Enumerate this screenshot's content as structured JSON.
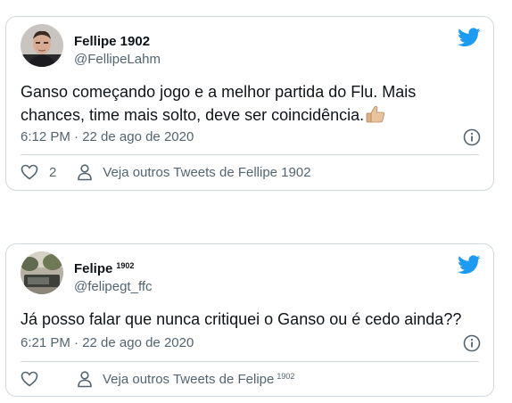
{
  "colors": {
    "twitter_blue": "#1d9bf0",
    "text_primary": "#0f1419",
    "text_secondary": "#536471",
    "border": "#cfd9de"
  },
  "tweets": [
    {
      "author": {
        "name": "Fellipe 1902",
        "name_superscript": "",
        "handle": "@FellipeLahm"
      },
      "text": "Ganso começando jogo e a melhor partida do Flu. Mais chances, time mais solto, deve ser coincidência.",
      "emoji": "thumbs-up-icon",
      "timestamp": "6:12 PM · 22 de ago de 2020",
      "like_count": "2",
      "more_link": "Veja outros Tweets de Fellipe 1902",
      "more_link_superscript": ""
    },
    {
      "author": {
        "name": "Felipe",
        "name_superscript": "1902",
        "handle": "@felipegt_ffc"
      },
      "text": "Já posso falar que nunca critiquei o Ganso ou é cedo ainda??",
      "emoji": "",
      "timestamp": "6:21 PM · 22 de ago de 2020",
      "like_count": "",
      "more_link": "Veja outros Tweets de Felipe",
      "more_link_superscript": "1902"
    }
  ]
}
